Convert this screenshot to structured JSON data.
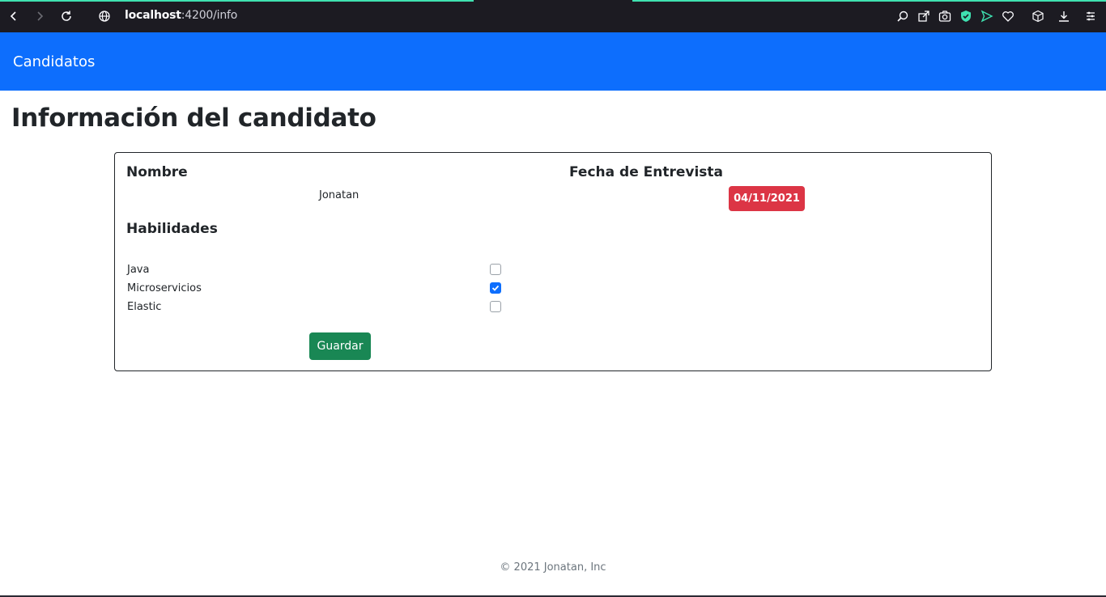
{
  "browser": {
    "url_host": "localhost",
    "url_path": ":4200/info"
  },
  "navbar": {
    "brand": "Candidatos"
  },
  "page": {
    "title": "Información del candidato"
  },
  "candidate": {
    "name_label": "Nombre",
    "name_value": "Jonatan",
    "date_label": "Fecha de Entrevista",
    "date_value": "04/11/2021",
    "skills_label": "Habilidades",
    "skills": [
      {
        "name": "Java",
        "checked": false
      },
      {
        "name": "Microservicios",
        "checked": true
      },
      {
        "name": "Elastic",
        "checked": false
      }
    ],
    "save_label": "Guardar"
  },
  "footer": {
    "text": "© 2021 Jonatan, Inc"
  },
  "colors": {
    "navbar": "#0d6efd",
    "date_badge": "#dc3545",
    "save_button": "#198754",
    "browser_chrome": "#1c1b22"
  },
  "icons": [
    "back-icon",
    "forward-icon",
    "reload-icon",
    "globe-icon",
    "zoom-icon",
    "share-icon",
    "camera-icon",
    "shield-icon",
    "send-icon",
    "heart-icon",
    "box-icon",
    "download-icon",
    "menu-icon"
  ]
}
